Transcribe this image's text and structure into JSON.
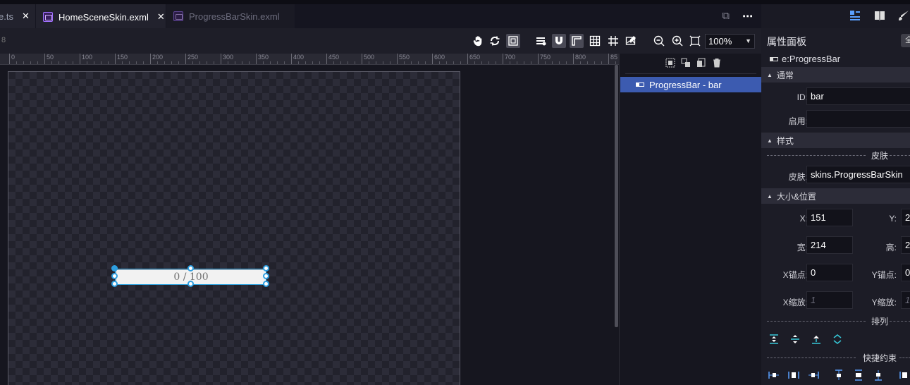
{
  "tabs": [
    {
      "label": "e.ts",
      "close": "✕"
    },
    {
      "label": "HomeSceneSkin.exml",
      "close": "✕"
    },
    {
      "label": "ProgressBarSkin.exml"
    }
  ],
  "tabbar_icons": {
    "copy": "⧉",
    "more": "⋯"
  },
  "toolbar": {
    "left_num": "8",
    "zoom": "100%",
    "icons": [
      "hand-icon",
      "refresh-icon",
      "fit-icon",
      "layers-icon",
      "magnet-icon",
      "corner-icon",
      "grid-icon",
      "hash-icon",
      "image-edit-icon",
      "zoom-out-icon",
      "zoom-in-icon",
      "fit-screen-icon"
    ]
  },
  "ruler": {
    "ticks": [
      "0",
      "50",
      "100",
      "150",
      "200",
      "250",
      "300",
      "350",
      "400",
      "450",
      "500",
      "550",
      "600",
      "650",
      "700",
      "750",
      "800",
      "85"
    ]
  },
  "stage": {
    "progress_text": "0 / 100"
  },
  "layers": {
    "rows": [
      {
        "label": "ProgressBar - bar"
      }
    ]
  },
  "props": {
    "title": "属性面板",
    "title_btn": "全",
    "component_type": "e:ProgressBar",
    "sections": {
      "general": "通常",
      "style": "样式",
      "size_pos": "大小&位置"
    },
    "skin_sub": "皮肤",
    "arrange_sub": "排列",
    "constraint_sub": "快捷约束",
    "fields": {
      "id_label": "ID:",
      "id_value": "bar",
      "enable_label": "启用:",
      "skin_label": "皮肤:",
      "skin_value": "skins.ProgressBarSkin",
      "x_label": "X:",
      "x_value": "151",
      "y_label": "Y:",
      "y_value": "2",
      "w_label": "宽:",
      "w_value": "214",
      "h_label": "高:",
      "h_value": "2",
      "xa_label": "X锚点:",
      "xa_value": "0",
      "ya_label": "Y锚点:",
      "ya_value": "0",
      "xs_label": "X缩放:",
      "xs_value": "1",
      "ys_label": "Y缩放:",
      "ys_value": "1"
    }
  }
}
